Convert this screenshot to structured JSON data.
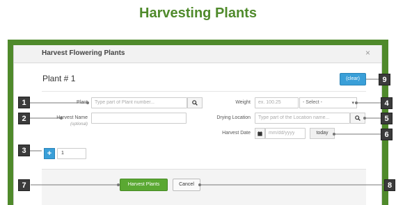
{
  "page_title": "Harvesting Plants",
  "dialog": {
    "title": "Harvest Flowering Plants",
    "close": "×",
    "plant_heading": "Plant # 1",
    "clear_label": "(clear)"
  },
  "fields": {
    "plant_label": "Plant",
    "plant_placeholder": "Type part of Plant number...",
    "harvest_name_label": "Harvest Name",
    "harvest_name_sublabel": "(optional)",
    "weight_label": "Weight",
    "weight_placeholder": "ex. 100.25",
    "weight_unit_selected": "- Select -",
    "drying_location_label": "Drying Location",
    "drying_location_placeholder": "Type part of the Location name...",
    "harvest_date_label": "Harvest Date",
    "harvest_date_placeholder": "mm/dd/yyyy",
    "today_label": "today"
  },
  "quantity": {
    "plus_label": "+",
    "value": "1"
  },
  "footer": {
    "harvest_button": "Harvest Plants",
    "cancel_button": "Cancel"
  },
  "callouts": [
    "1",
    "2",
    "3",
    "4",
    "5",
    "6",
    "7",
    "8",
    "9"
  ],
  "colors": {
    "title_green": "#4f8a2b",
    "frame_green": "#4f8a2b",
    "primary_blue": "#3a9fd8",
    "harvest_green": "#5aa832",
    "badge_dark": "#3b3b3b"
  }
}
